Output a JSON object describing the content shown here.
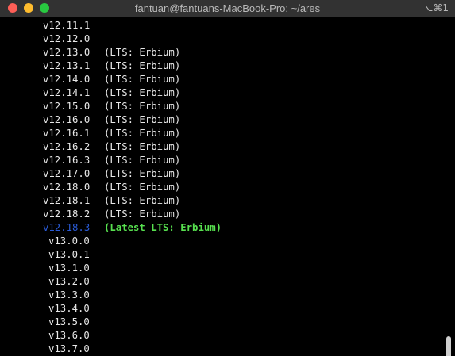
{
  "window": {
    "title": "fantuan@fantuans-MacBook-Pro: ~/ares",
    "shortcut": "⌥⌘1"
  },
  "terminal": {
    "lines": [
      {
        "version": "v12.11.1",
        "note": ""
      },
      {
        "version": "v12.12.0",
        "note": ""
      },
      {
        "version": "v12.13.0",
        "note": "(LTS: Erbium)"
      },
      {
        "version": "v12.13.1",
        "note": "(LTS: Erbium)"
      },
      {
        "version": "v12.14.0",
        "note": "(LTS: Erbium)"
      },
      {
        "version": "v12.14.1",
        "note": "(LTS: Erbium)"
      },
      {
        "version": "v12.15.0",
        "note": "(LTS: Erbium)"
      },
      {
        "version": "v12.16.0",
        "note": "(LTS: Erbium)"
      },
      {
        "version": "v12.16.1",
        "note": "(LTS: Erbium)"
      },
      {
        "version": "v12.16.2",
        "note": "(LTS: Erbium)"
      },
      {
        "version": "v12.16.3",
        "note": "(LTS: Erbium)"
      },
      {
        "version": "v12.17.0",
        "note": "(LTS: Erbium)"
      },
      {
        "version": "v12.18.0",
        "note": "(LTS: Erbium)"
      },
      {
        "version": "v12.18.1",
        "note": "(LTS: Erbium)"
      },
      {
        "version": "v12.18.2",
        "note": "(LTS: Erbium)"
      },
      {
        "version": "v12.18.3",
        "note": "(Latest LTS: Erbium)"
      },
      {
        "version": "v13.0.0",
        "note": ""
      },
      {
        "version": "v13.0.1",
        "note": ""
      },
      {
        "version": "v13.1.0",
        "note": ""
      },
      {
        "version": "v13.2.0",
        "note": ""
      },
      {
        "version": "v13.3.0",
        "note": ""
      },
      {
        "version": "v13.4.0",
        "note": ""
      },
      {
        "version": "v13.5.0",
        "note": ""
      },
      {
        "version": "v13.6.0",
        "note": ""
      },
      {
        "version": "v13.7.0",
        "note": ""
      }
    ]
  },
  "colors": {
    "current_version": "#2a5bd7",
    "latest_lts": "#57e04f",
    "text": "#e8e8e8",
    "background": "#000000"
  }
}
